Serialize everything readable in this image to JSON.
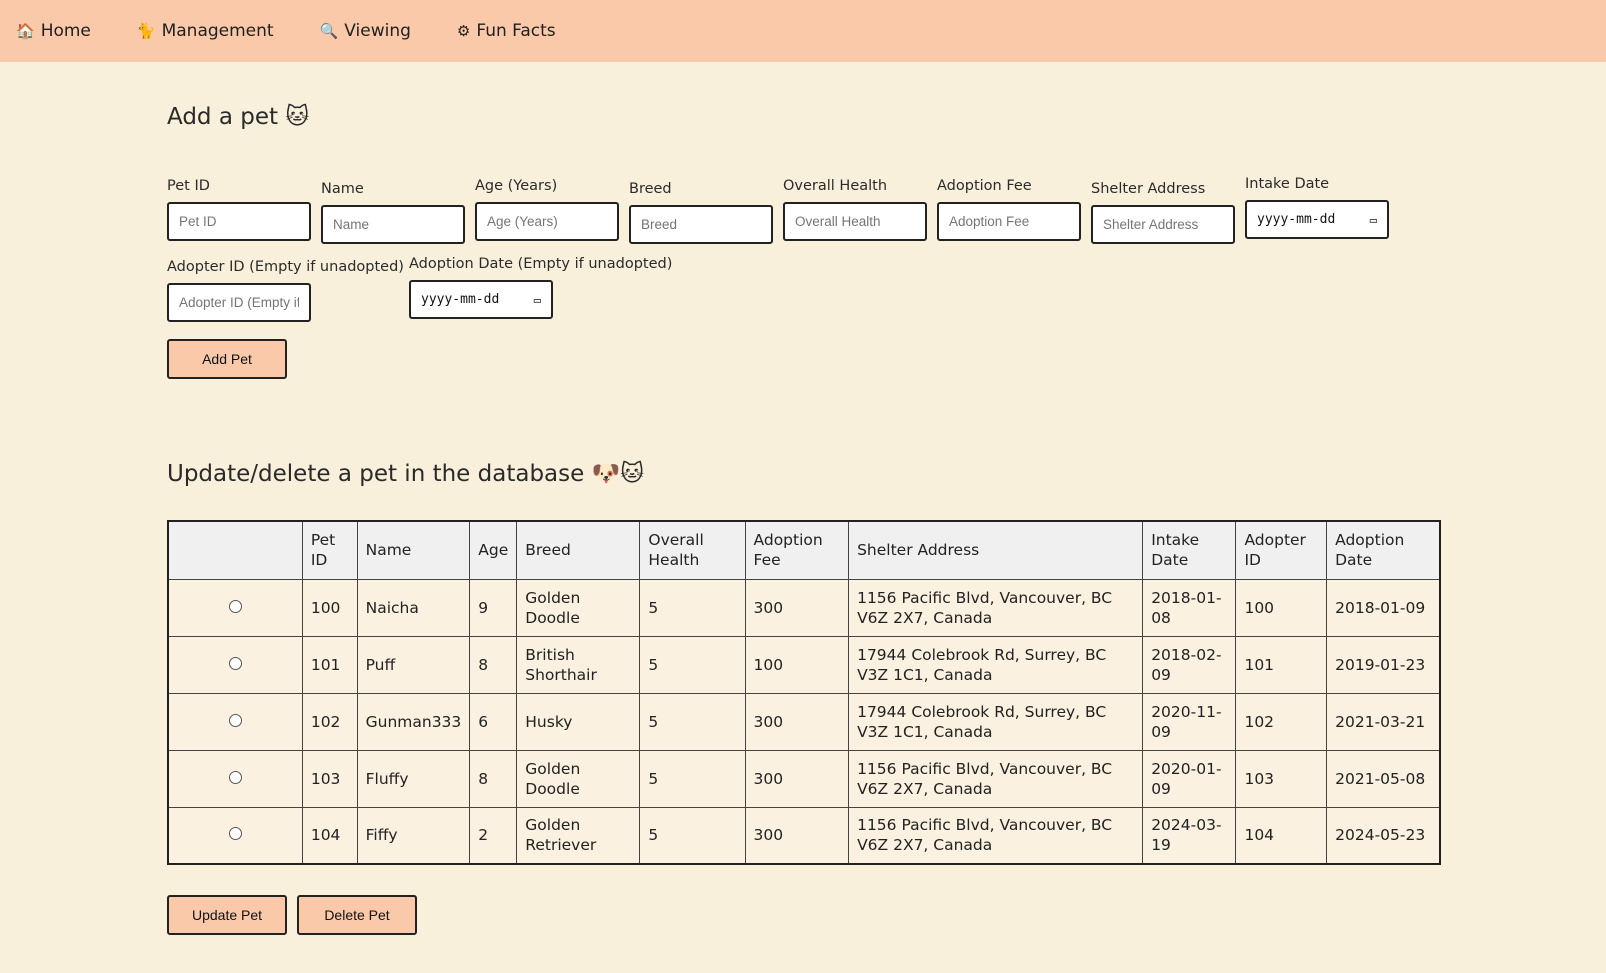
{
  "nav": [
    {
      "icon": "🏠",
      "icon_name": "home-icon",
      "label": "Home"
    },
    {
      "icon": "🐈",
      "icon_name": "cat-icon",
      "label": "Management"
    },
    {
      "icon": "🔍",
      "icon_name": "search-icon",
      "label": "Viewing"
    },
    {
      "icon": "⚙",
      "icon_name": "sliders-icon",
      "label": "Fun Facts"
    }
  ],
  "add": {
    "title": "Add a pet 🐱",
    "fields": {
      "pet_id": {
        "label": "Pet ID",
        "placeholder": "Pet ID"
      },
      "name": {
        "label": "Name",
        "placeholder": "Name"
      },
      "age": {
        "label": "Age (Years)",
        "placeholder": "Age (Years)"
      },
      "breed": {
        "label": "Breed",
        "placeholder": "Breed"
      },
      "health": {
        "label": "Overall Health",
        "placeholder": "Overall Health"
      },
      "fee": {
        "label": "Adoption Fee",
        "placeholder": "Adoption Fee"
      },
      "address": {
        "label": "Shelter Address",
        "placeholder": "Shelter Address"
      },
      "intake": {
        "label": "Intake Date",
        "value": "yyyy-mm-dd"
      },
      "adopter_id": {
        "label": "Adopter ID (Empty if unadopted)",
        "placeholder": "Adopter ID (Empty if unadopted)"
      },
      "adoption_date": {
        "label": "Adoption Date (Empty if unadopted)",
        "value": "yyyy-mm-dd"
      }
    },
    "button": "Add Pet"
  },
  "update": {
    "title": "Update/delete a pet in the database 🐶🐱",
    "columns": [
      "",
      "Pet ID",
      "Name",
      "Age",
      "Breed",
      "Overall Health",
      "Adoption Fee",
      "Shelter Address",
      "Intake Date",
      "Adopter ID",
      "Adoption Date"
    ],
    "rows": [
      [
        "100",
        "Naicha",
        "9",
        "Golden Doodle",
        "5",
        "300",
        "1156 Pacific Blvd, Vancouver, BC V6Z 2X7, Canada",
        "2018-01-08",
        "100",
        "2018-01-09"
      ],
      [
        "101",
        "Puff",
        "8",
        "British Shorthair",
        "5",
        "100",
        "17944 Colebrook Rd, Surrey, BC V3Z 1C1, Canada",
        "2018-02-09",
        "101",
        "2019-01-23"
      ],
      [
        "102",
        "Gunman333",
        "6",
        "Husky",
        "5",
        "300",
        "17944 Colebrook Rd, Surrey, BC V3Z 1C1, Canada",
        "2020-11-09",
        "102",
        "2021-03-21"
      ],
      [
        "103",
        "Fluffy",
        "8",
        "Golden Doodle",
        "5",
        "300",
        "1156 Pacific Blvd, Vancouver, BC V6Z 2X7, Canada",
        "2020-01-09",
        "103",
        "2021-05-08"
      ],
      [
        "104",
        "Fiffy",
        "2",
        "Golden Retriever",
        "5",
        "300",
        "1156 Pacific Blvd, Vancouver, BC V6Z 2X7, Canada",
        "2024-03-19",
        "104",
        "2024-05-23"
      ]
    ],
    "update_button": "Update Pet",
    "delete_button": "Delete Pet"
  }
}
